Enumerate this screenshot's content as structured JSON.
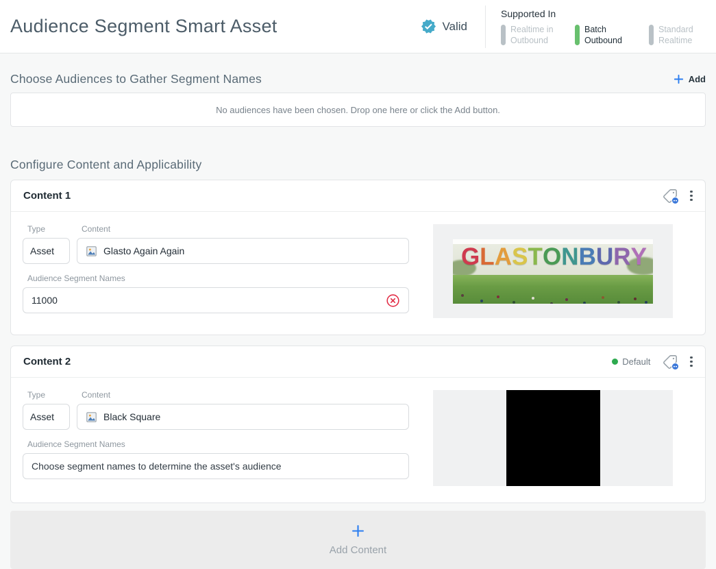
{
  "header": {
    "title": "Audience Segment Smart Asset",
    "status_badge": {
      "label": "Valid",
      "color": "#45aac9"
    },
    "supported_in": {
      "label": "Supported In",
      "items": [
        {
          "label": "Realtime in Outbound",
          "active": false
        },
        {
          "label": "Batch Outbound",
          "active": true
        },
        {
          "label": "Standard Realtime",
          "active": false
        }
      ],
      "active_color": "#68c06e",
      "inactive_color": "#b9c1c6"
    }
  },
  "audiences_section": {
    "heading": "Choose Audiences to Gather Segment Names",
    "add_button_label": "Add",
    "empty_message": "No audiences have been chosen. Drop one here or click the Add button."
  },
  "content_section": {
    "heading": "Configure Content and Applicability",
    "cards": [
      {
        "title": "Content 1",
        "fields": {
          "type_label": "Type",
          "type_value": "Asset",
          "content_label": "Content",
          "content_value": "Glasto Again Again",
          "segments_label": "Audience Segment Names",
          "segments_value": "11000"
        },
        "has_error": true,
        "preview": {
          "kind": "photo",
          "description": "Glastonbury sign photo",
          "letters": [
            {
              "ch": "G",
              "color": "#cf3a4e"
            },
            {
              "ch": "L",
              "color": "#d96a35"
            },
            {
              "ch": "A",
              "color": "#e39c3c"
            },
            {
              "ch": "S",
              "color": "#d9c54a"
            },
            {
              "ch": "T",
              "color": "#8ab84d"
            },
            {
              "ch": "O",
              "color": "#4a9a55"
            },
            {
              "ch": "N",
              "color": "#3f968f"
            },
            {
              "ch": "B",
              "color": "#4a7cb5"
            },
            {
              "ch": "U",
              "color": "#5e68ae"
            },
            {
              "ch": "R",
              "color": "#8e66ad"
            },
            {
              "ch": "Y",
              "color": "#b06fb8"
            }
          ]
        }
      },
      {
        "title": "Content 2",
        "default_badge": "Default",
        "fields": {
          "type_label": "Type",
          "type_value": "Asset",
          "content_label": "Content",
          "content_value": "Black Square",
          "segments_label": "Audience Segment Names",
          "segments_placeholder": "Choose segment names to determine the asset's audience"
        },
        "has_error": false,
        "preview": {
          "kind": "black-square",
          "color": "#000000"
        }
      }
    ],
    "add_content_label": "Add Content"
  },
  "colors": {
    "accent_blue": "#2c7ef0",
    "valid_teal": "#45aac9",
    "active_green": "#68c06e",
    "default_green": "#2daa4f",
    "error_red": "#e22d46"
  }
}
